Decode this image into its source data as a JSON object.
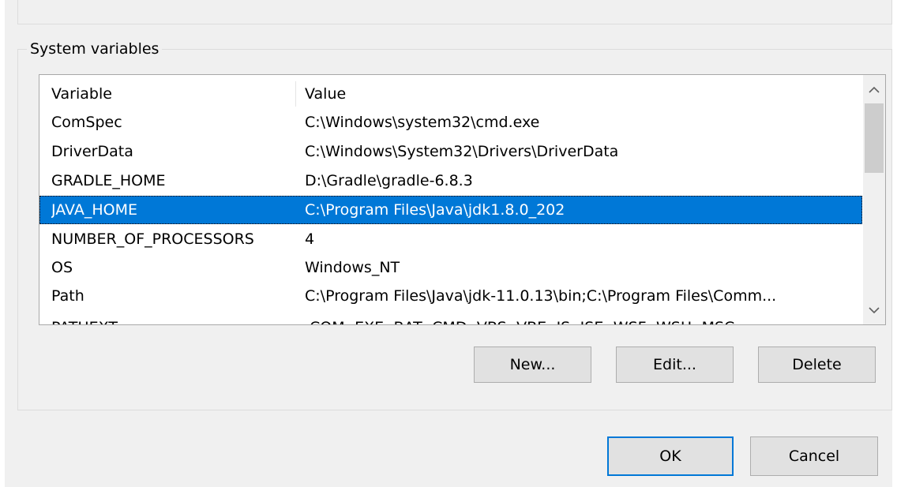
{
  "system_variables": {
    "group_label": "System variables",
    "columns": [
      "Variable",
      "Value"
    ],
    "rows": [
      {
        "variable": "ComSpec",
        "value": "C:\\Windows\\system32\\cmd.exe"
      },
      {
        "variable": "DriverData",
        "value": "C:\\Windows\\System32\\Drivers\\DriverData"
      },
      {
        "variable": "GRADLE_HOME",
        "value": "D:\\Gradle\\gradle-6.8.3"
      },
      {
        "variable": "JAVA_HOME",
        "value": "C:\\Program Files\\Java\\jdk1.8.0_202",
        "selected": true
      },
      {
        "variable": "NUMBER_OF_PROCESSORS",
        "value": "4"
      },
      {
        "variable": "OS",
        "value": "Windows_NT"
      },
      {
        "variable": "Path",
        "value": "C:\\Program Files\\Java\\jdk-11.0.13\\bin;C:\\Program Files\\Comm..."
      },
      {
        "variable": "PATHEXT",
        "value": ".COM;.EXE;.BAT;.CMD;.VBS;.VBE;.JS;.JSE;.WSF;.WSH;.MSC"
      }
    ],
    "buttons": {
      "new": "New...",
      "edit": "Edit...",
      "delete": "Delete"
    }
  },
  "dialog": {
    "ok": "OK",
    "cancel": "Cancel"
  },
  "colors": {
    "selection": "#0078d7",
    "dialog_background": "#f0f0f0"
  },
  "icons": {
    "scroll_up": "chevron-up-icon",
    "scroll_down": "chevron-down-icon"
  }
}
